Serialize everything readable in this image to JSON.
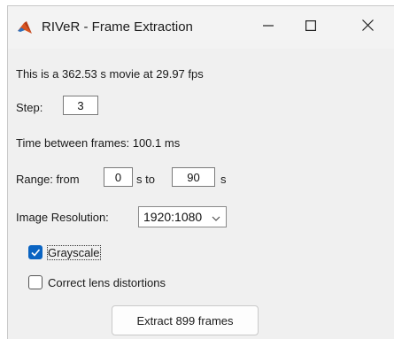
{
  "window": {
    "title": "RIVeR - Frame Extraction"
  },
  "info": {
    "movie_text": "This is a 362.53 s movie at 29.97 fps",
    "time_between_frames": "Time between frames: 100.1 ms"
  },
  "step": {
    "label": "Step:",
    "value": "3"
  },
  "range": {
    "from_label": "Range: from",
    "from_value": "0",
    "to_label": "s to",
    "to_value": "90",
    "unit": "s"
  },
  "resolution": {
    "label": "Image Resolution:",
    "selected": "1920:1080"
  },
  "options": {
    "grayscale_label": "Grayscale",
    "grayscale_checked": true,
    "lens_label": "Correct lens distortions",
    "lens_checked": false
  },
  "actions": {
    "extract_label": "Extract 899 frames"
  },
  "colors": {
    "accent": "#0a64c2",
    "window_bg": "#f0f0f0"
  },
  "icons": {
    "app": "matlab-logo-icon",
    "minimize": "minimize-icon",
    "maximize": "maximize-icon",
    "close": "close-icon",
    "dropdown": "chevron-down-icon",
    "check": "checkmark-icon"
  }
}
